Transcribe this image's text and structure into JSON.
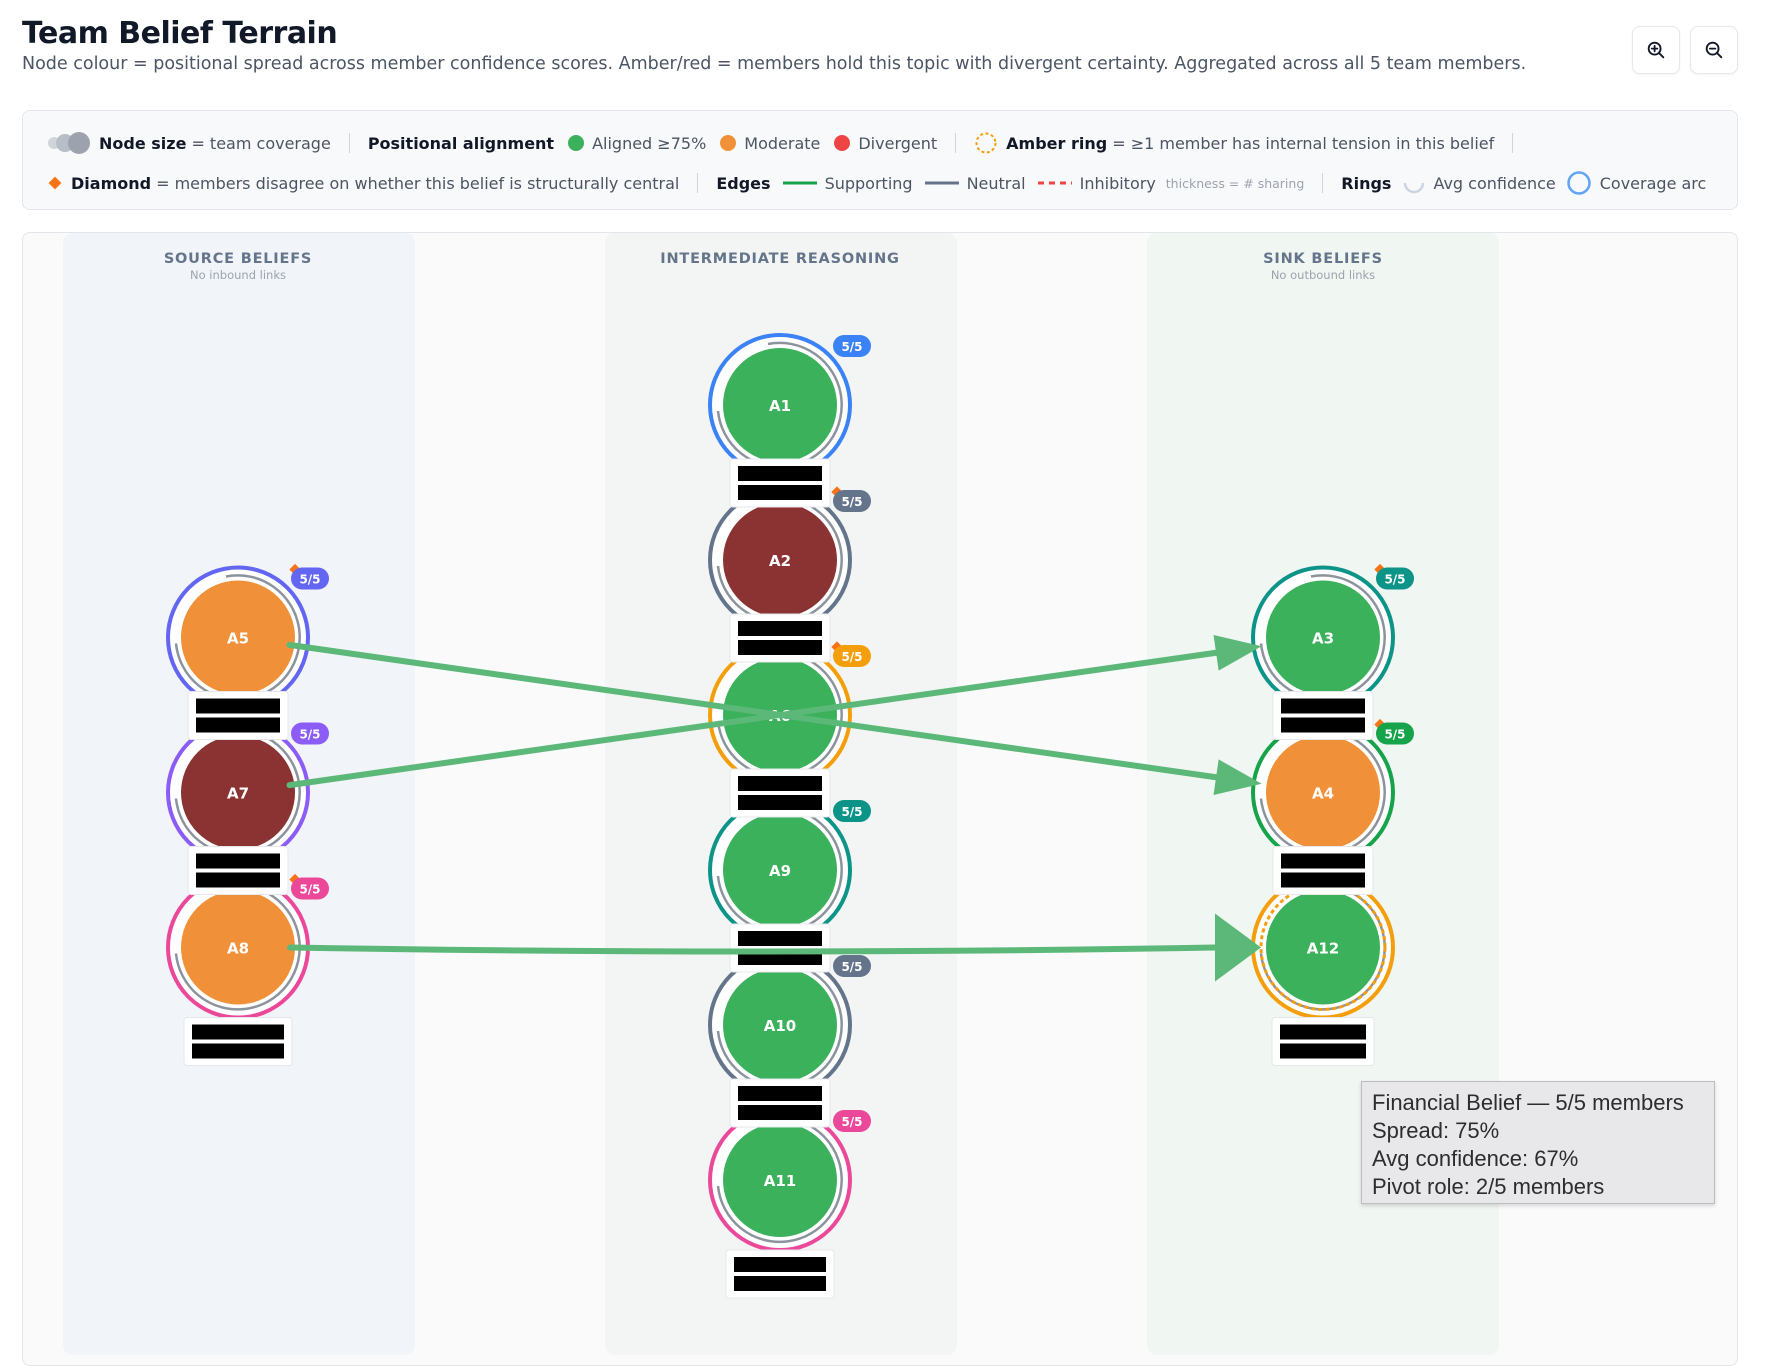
{
  "header": {
    "title": "Team Belief Terrain",
    "subtitle": "Node colour = positional spread across member confidence scores. Amber/red = members hold this topic with divergent certainty. Aggregated across all 5 team members."
  },
  "toolbar": {
    "zoom_in_icon": "zoom-in-icon",
    "zoom_out_icon": "zoom-out-icon"
  },
  "legend": {
    "node_size_label": "Node size",
    "node_size_text": "= team coverage",
    "alignment_label": "Positional alignment",
    "aligned": "Aligned ≥75%",
    "moderate": "Moderate",
    "divergent": "Divergent",
    "amber_ring_label": "Amber ring",
    "amber_ring_text": "= ≥1 member has internal tension in this belief",
    "diamond_label": "Diamond",
    "diamond_text": "= members disagree on whether this belief is structurally central",
    "edges_label": "Edges",
    "supporting": "Supporting",
    "neutral": "Neutral",
    "inhibitory": "Inhibitory",
    "thickness": "thickness = # sharing",
    "rings_label": "Rings",
    "avg_confidence": "Avg confidence",
    "coverage_arc": "Coverage arc"
  },
  "colors": {
    "aligned": "#3cb15c",
    "moderate": "#f0913a",
    "divergent": "#8b3232",
    "supporting_edge": "#5cb878",
    "neutral_edge": "#64748b",
    "inhibitory_edge": "#ef4444",
    "amber_ring": "#f59e0b",
    "diamond": "#f97316"
  },
  "columns": [
    {
      "id": "source",
      "title": "SOURCE BELIEFS",
      "sub": "No inbound links"
    },
    {
      "id": "intermediate",
      "title": "INTERMEDIATE REASONING",
      "sub": ""
    },
    {
      "id": "sink",
      "title": "SINK BELIEFS",
      "sub": "No outbound links"
    }
  ],
  "nodes": [
    {
      "id": "A1",
      "col": "intermediate",
      "row": 0,
      "fill": "aligned",
      "ring": "#3b82f6",
      "badge": "5/5",
      "badge_color": "#3b82f6",
      "diamond": false,
      "amber": false,
      "label_above": false
    },
    {
      "id": "A2",
      "col": "intermediate",
      "row": 1,
      "fill": "divergent",
      "ring": "#64748b",
      "badge": "5/5",
      "badge_color": "#64748b",
      "diamond": true,
      "amber": false,
      "label_above": true
    },
    {
      "id": "A6",
      "col": "intermediate",
      "row": 2,
      "fill": "aligned",
      "ring": "#f59e0b",
      "badge": "5/5",
      "badge_color": "#f59e0b",
      "diamond": true,
      "amber": false,
      "label_above": true
    },
    {
      "id": "A9",
      "col": "intermediate",
      "row": 3,
      "fill": "aligned",
      "ring": "#0d9488",
      "badge": "5/5",
      "badge_color": "#0d9488",
      "diamond": false,
      "amber": false,
      "label_above": true
    },
    {
      "id": "A10",
      "col": "intermediate",
      "row": 4,
      "fill": "aligned",
      "ring": "#64748b",
      "badge": "5/5",
      "badge_color": "#64748b",
      "diamond": false,
      "amber": false,
      "label_above": true
    },
    {
      "id": "A11",
      "col": "intermediate",
      "row": 5,
      "fill": "aligned",
      "ring": "#ec4899",
      "badge": "5/5",
      "badge_color": "#ec4899",
      "diamond": false,
      "amber": false,
      "label_above": true
    },
    {
      "id": "A5",
      "col": "source",
      "row": 1.5,
      "fill": "moderate",
      "ring": "#6366f1",
      "badge": "5/5",
      "badge_color": "#6366f1",
      "diamond": true,
      "amber": false,
      "label_above": false
    },
    {
      "id": "A7",
      "col": "source",
      "row": 2.5,
      "fill": "divergent",
      "ring": "#8b5cf6",
      "badge": "5/5",
      "badge_color": "#8b5cf6",
      "diamond": false,
      "amber": false,
      "label_above": true
    },
    {
      "id": "A8",
      "col": "source",
      "row": 3.5,
      "fill": "moderate",
      "ring": "#ec4899",
      "badge": "5/5",
      "badge_color": "#ec4899",
      "diamond": true,
      "amber": false,
      "label_above": true
    },
    {
      "id": "A3",
      "col": "sink",
      "row": 1.5,
      "fill": "aligned",
      "ring": "#0d9488",
      "badge": "5/5",
      "badge_color": "#0d9488",
      "diamond": true,
      "amber": false,
      "label_above": false
    },
    {
      "id": "A4",
      "col": "sink",
      "row": 2.5,
      "fill": "moderate",
      "ring": "#16a34a",
      "badge": "5/5",
      "badge_color": "#16a34a",
      "diamond": true,
      "amber": false,
      "label_above": true
    },
    {
      "id": "A12",
      "col": "sink",
      "row": 3.5,
      "fill": "aligned",
      "ring": "#f59e0b",
      "badge": "",
      "badge_color": "#f59e0b",
      "diamond": false,
      "amber": true,
      "label_above": true
    }
  ],
  "label_below": [
    "A8",
    "A12",
    "A11"
  ],
  "edges": [
    {
      "from": "A5",
      "to": "A4",
      "type": "supporting"
    },
    {
      "from": "A7",
      "to": "A3",
      "type": "supporting"
    },
    {
      "from": "A8",
      "to": "A12",
      "type": "supporting"
    }
  ],
  "tooltip": {
    "lines": [
      "Financial Belief — 5/5 members",
      "Spread: 75%",
      "Avg confidence: 67%",
      "Pivot role: 2/5 members"
    ]
  }
}
